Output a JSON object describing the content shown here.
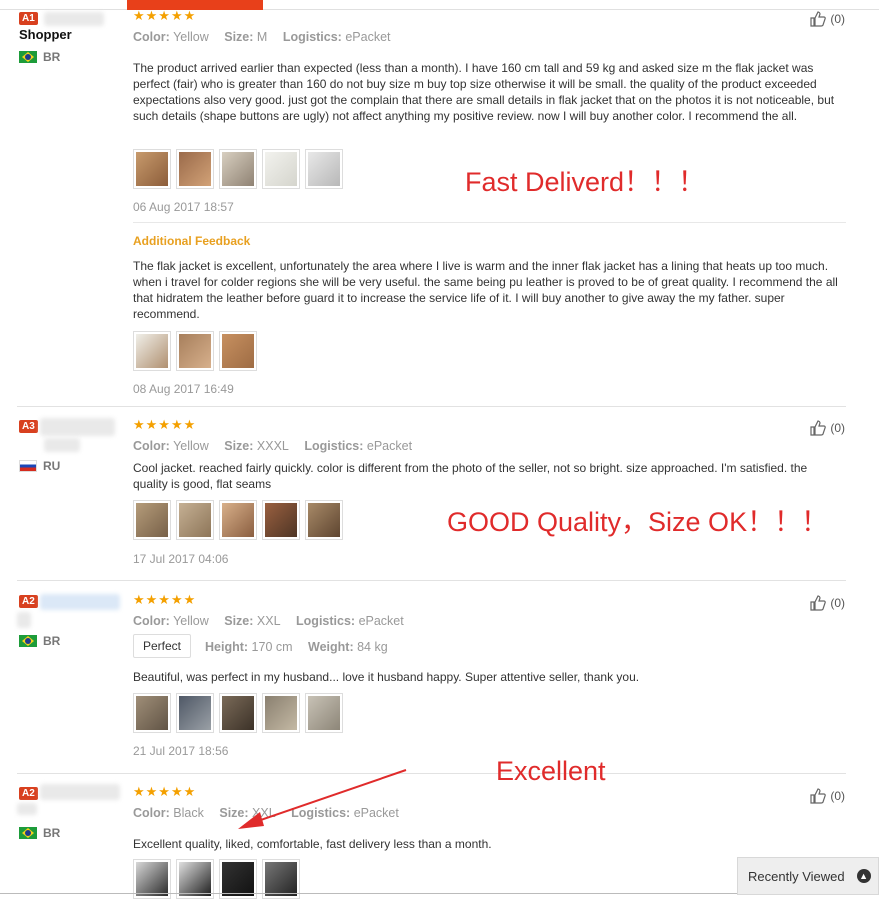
{
  "reviews": [
    {
      "badge": "A1",
      "name": "Shopper",
      "country": "BR",
      "stars": "★★★★★",
      "color_label": "Color:",
      "color": "Yellow",
      "size_label": "Size:",
      "size": "M",
      "logistics_label": "Logistics:",
      "logistics": "ePacket",
      "helpful": "(0)",
      "text": "The product arrived earlier than expected (less than a month). I have 160 cm tall and 59 kg and asked size m the flak jacket was perfect (fair) who is greater than 160 do not buy size m buy top size otherwise it will be small. the quality of the product exceeded expectations also very good. just got the complain that there are small details in flak jacket that on the photos it is not noticeable, but such details (shape buttons are ugly) not affect anything my positive review. now I will buy another color. I recommend the all.",
      "date": "06 Aug 2017 18:57",
      "additional_label": "Additional Feedback",
      "additional_text": "The flak jacket is excellent, unfortunately the area where I live is warm and the inner flak jacket has a lining that heats up too much. when i travel for colder regions she will be very useful. the same being pu leather is proved to be of great quality. I recommend the all that hidratem the leather before guard it to increase the service life of it. I will buy another to give away the my father. super recommend.",
      "additional_date": "08 Aug 2017 16:49",
      "annotation": "Fast Deliverd！！！"
    },
    {
      "badge": "A3",
      "country": "RU",
      "stars": "★★★★★",
      "color_label": "Color:",
      "color": "Yellow",
      "size_label": "Size:",
      "size": "XXXL",
      "logistics_label": "Logistics:",
      "logistics": "ePacket",
      "helpful": "(0)",
      "text": "Cool jacket. reached fairly quickly. color is different from the photo of the seller, not so bright. size approached. I'm satisfied. the quality is good, flat seams",
      "date": "17 Jul 2017 04:06",
      "annotation": "GOOD Quality，Size OK！！！"
    },
    {
      "badge": "A2",
      "country": "BR",
      "stars": "★★★★★",
      "color_label": "Color:",
      "color": "Yellow",
      "size_label": "Size:",
      "size": "XXL",
      "logistics_label": "Logistics:",
      "logistics": "ePacket",
      "helpful": "(0)",
      "fit": "Perfect",
      "height_label": "Height:",
      "height": "170 cm",
      "weight_label": "Weight:",
      "weight": "84 kg",
      "text": "Beautiful, was perfect in my husband... love it husband happy. Super attentive seller, thank you.",
      "date": "21 Jul 2017 18:56"
    },
    {
      "badge": "A2",
      "country": "BR",
      "stars": "★★★★★",
      "color_label": "Color:",
      "color": "Black",
      "size_label": "Size:",
      "size": "XXL",
      "logistics_label": "Logistics:",
      "logistics": "ePacket",
      "helpful": "(0)",
      "text": "Excellent quality, liked, comfortable, fast delivery less than a month.",
      "annotation": "Excellent"
    }
  ],
  "recently_viewed": "Recently Viewed",
  "icons": {
    "helpful": "thumbs-up-icon",
    "recent": "chevron-up-icon"
  },
  "colors": {
    "accent": "#e8401a",
    "stars": "#f4a000",
    "annotation": "#e02b2b",
    "additional": "#e8a020"
  }
}
